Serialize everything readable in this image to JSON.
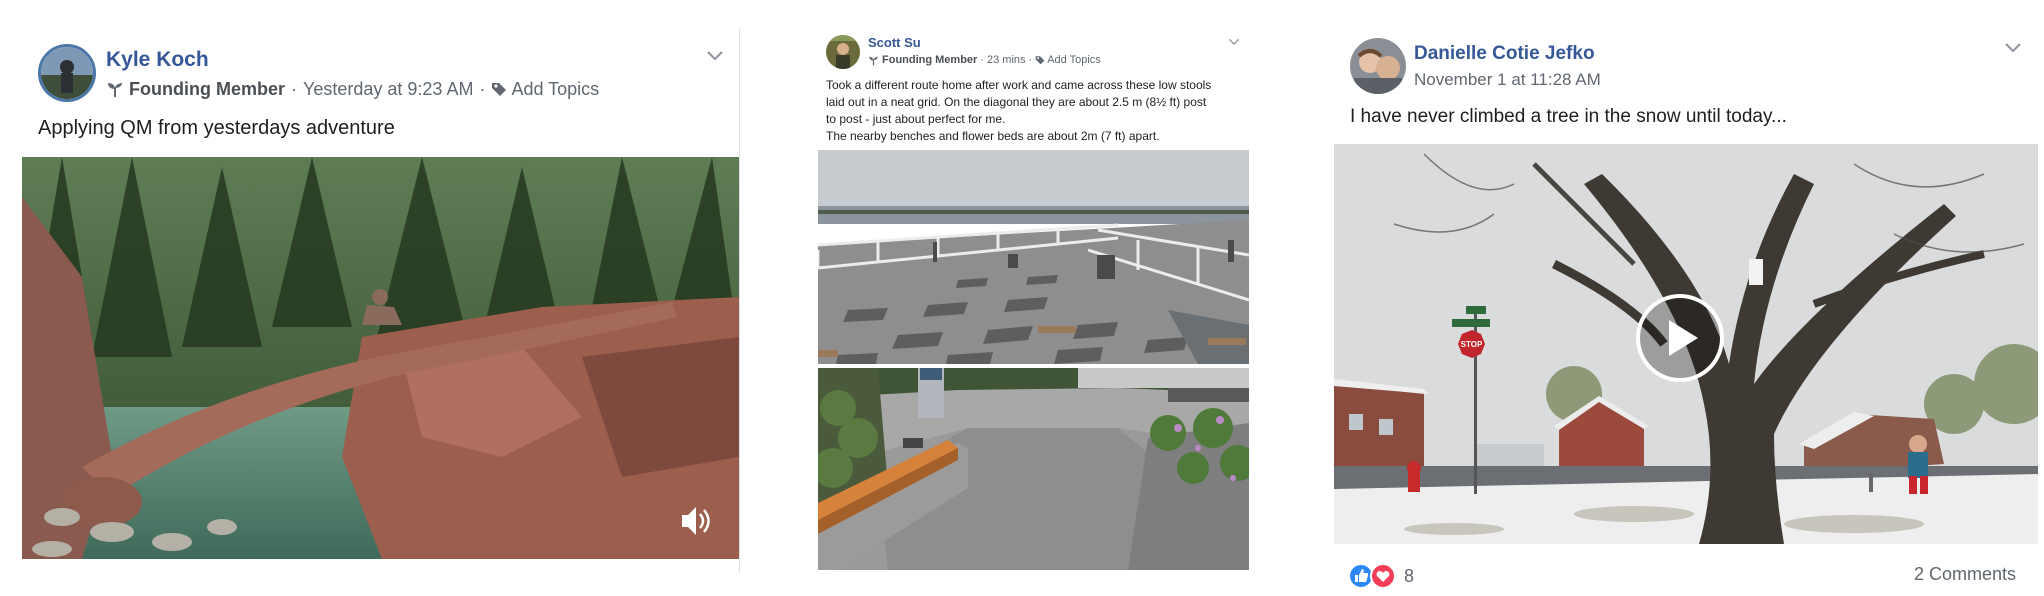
{
  "posts": [
    {
      "author": "Kyle Koch",
      "badge": "Founding Member",
      "time": "Yesterday at 9:23 AM",
      "add_topics": "Add Topics",
      "text": "Applying QM from yesterdays adventure",
      "media_icons": [
        "volume-icon"
      ]
    },
    {
      "author": "Scott Su",
      "badge": "Founding Member",
      "time": "23 mins",
      "add_topics": "Add Topics",
      "text": "Took a different route home after work and came across these low stools\nlaid out in a neat grid. On the diagonal they are about 2.5 m (8½ ft) post\nto post - just about perfect for me.\nThe nearby benches and flower beds are about 2m (7 ft) apart."
    },
    {
      "author": "Danielle Cotie Jefko",
      "time": "November 1 at 11:28 AM",
      "text": "I have never climbed a tree in the snow until today...",
      "reactions_count": "8",
      "comments": "2 Comments",
      "sign_text": "STOP",
      "media_icons": [
        "play-icon",
        "like-icon",
        "love-icon"
      ]
    }
  ],
  "separator": "·"
}
